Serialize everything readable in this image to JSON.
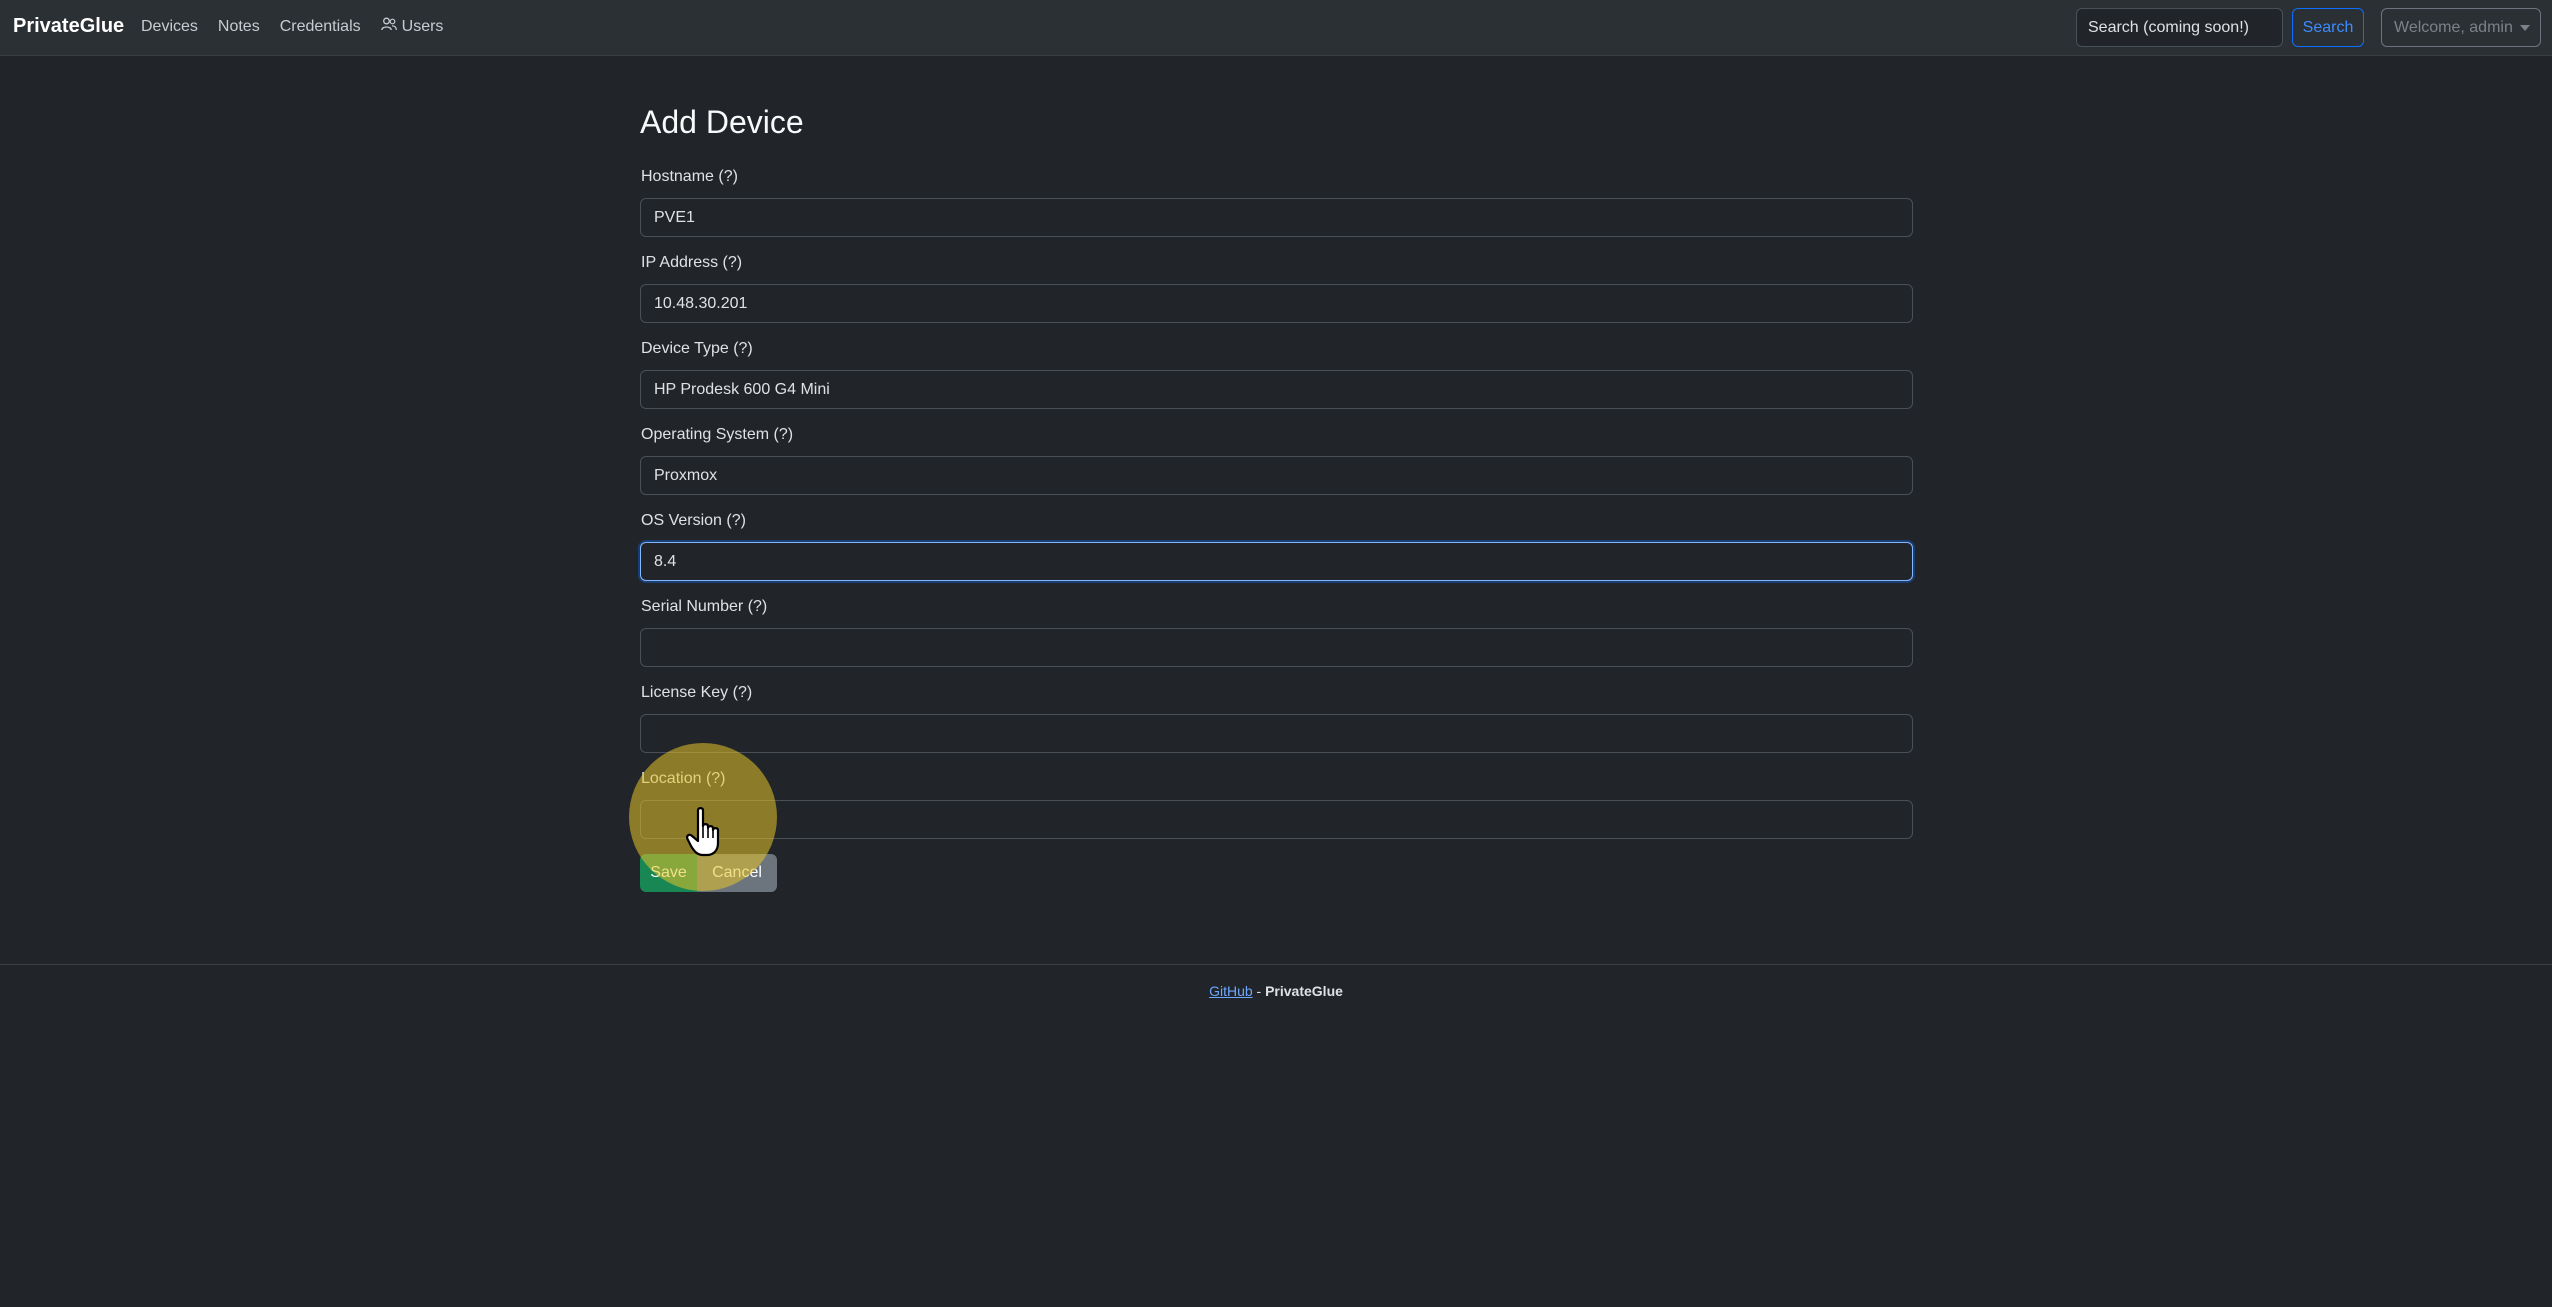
{
  "navbar": {
    "brand": "PrivateGlue",
    "links": [
      {
        "label": "Devices"
      },
      {
        "label": "Notes"
      },
      {
        "label": "Credentials"
      },
      {
        "label": "Users",
        "icon": "users-icon"
      }
    ],
    "search_placeholder": "Search (coming soon!)",
    "search_button": "Search",
    "user_menu": "Welcome, admin"
  },
  "form": {
    "title": "Add Device",
    "fields": [
      {
        "label": "Hostname (?)",
        "value": "PVE1"
      },
      {
        "label": "IP Address (?)",
        "value": "10.48.30.201"
      },
      {
        "label": "Device Type (?)",
        "value": "HP Prodesk 600 G4 Mini"
      },
      {
        "label": "Operating System (?)",
        "value": "Proxmox"
      },
      {
        "label": "OS Version (?)",
        "value": "8.4"
      },
      {
        "label": "Serial Number (?)",
        "value": ""
      },
      {
        "label": "License Key (?)",
        "value": ""
      },
      {
        "label": "Location (?)",
        "value": ""
      }
    ],
    "save_label": "Save",
    "cancel_label": "Cancel"
  },
  "footer": {
    "link_label": "GitHub",
    "separator": " - ",
    "brand": "PrivateGlue"
  },
  "colors": {
    "background": "#212529",
    "navbar": "#2b3035",
    "accent": "#0d6efd",
    "save": "#198754",
    "cancel": "#6c757d",
    "click_highlight": "#e6c328"
  }
}
